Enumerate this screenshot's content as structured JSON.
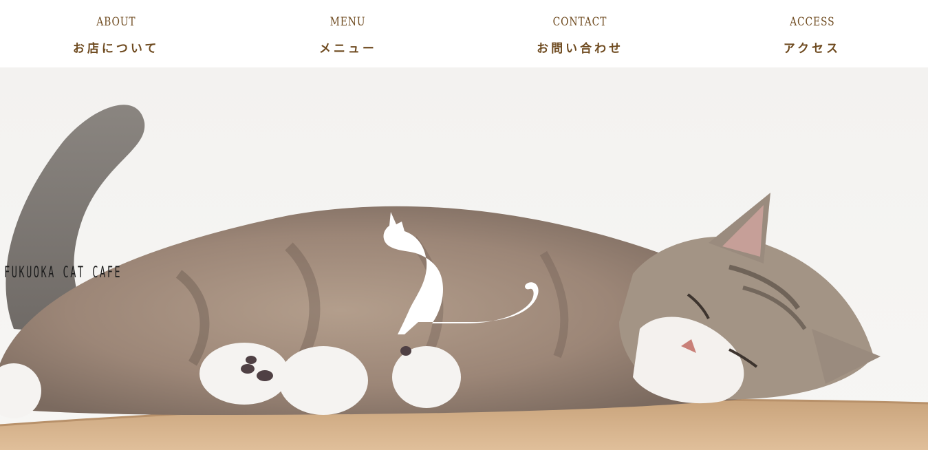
{
  "nav": {
    "items": [
      {
        "en": "ABOUT",
        "jp": "お店について"
      },
      {
        "en": "MENU",
        "jp": "メニュー"
      },
      {
        "en": "CONTACT",
        "jp": "お問い合わせ"
      },
      {
        "en": "ACCESS",
        "jp": "アクセス"
      }
    ]
  },
  "hero": {
    "logo_text": "FUKUOKA CAT CAFE"
  },
  "colors": {
    "nav_text": "#6e4a1f",
    "background": "#ffffff",
    "logo_silhouette": "#ffffff"
  },
  "icons": {
    "logo": "cat-silhouette-icon"
  }
}
